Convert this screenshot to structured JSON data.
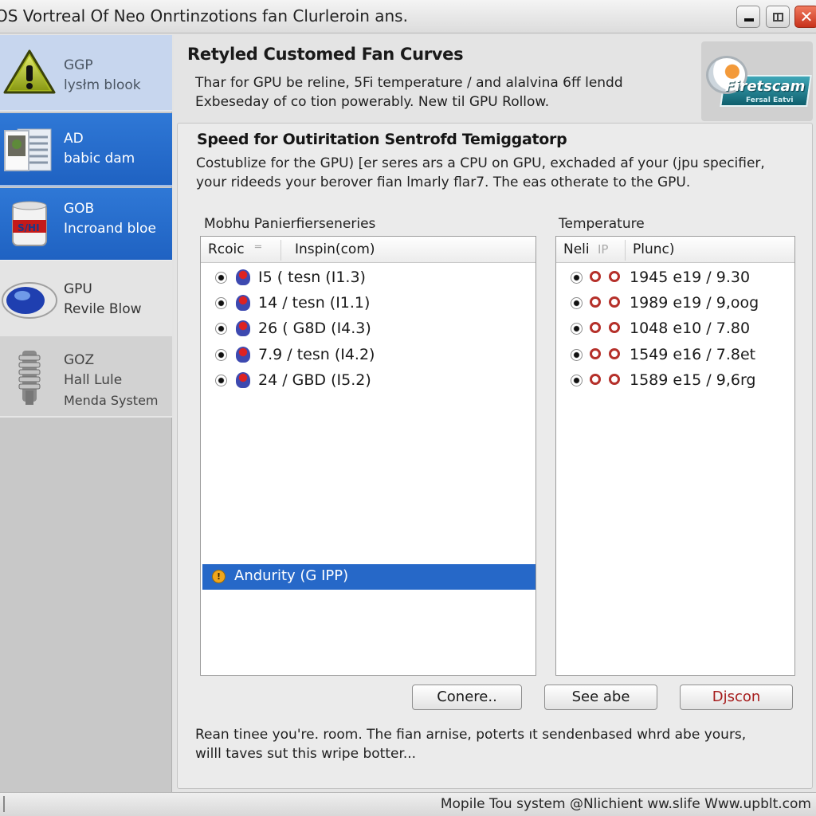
{
  "window": {
    "title": "OS Vortreal Of Neo Onrtinzotions fan Clurleroin ans.",
    "controls": {
      "minimize": "minimize",
      "maximize": "maximize",
      "close": "✕"
    }
  },
  "sidebar": {
    "items": [
      {
        "line1": "GGP",
        "line2": "lysłm blook",
        "icon": "warning-icon",
        "state": "hover"
      },
      {
        "line1": "AD",
        "line2": "babic dam",
        "icon": "document-icon",
        "state": "selected"
      },
      {
        "line1": "GOB",
        "line2": "Incroand bloe",
        "icon": "paint-can-icon",
        "state": "selected"
      },
      {
        "line1": "GPU",
        "line2": "Revile Blow",
        "icon": "globe-disc-icon",
        "state": "normal"
      },
      {
        "line1": "GOZ",
        "line2": "Hall Lule",
        "line3": "Menda System",
        "icon": "heatsink-icon",
        "state": "normal"
      }
    ]
  },
  "header": {
    "title": "Retyled Customed Fan Curves",
    "desc_line1": "Thar for GPU be reline, 5Fi temperature / and alalvina 6ff lendd",
    "desc_line2": "Exbeseday of co tion powerably. New til GPU Rollow.",
    "logo": {
      "brand": "Firetscam",
      "subtitle": "Fersal Eatvi"
    }
  },
  "panel": {
    "title": "Speed for Outiritation Sentrofd Temiggatorp",
    "desc_line1": "Costublize for the GPU) [er seres ars a CPU on GPU, exchaded af your (jpu specifier,",
    "desc_line2": "your rideeds your berover fian lmarly flar7. The eas otherate to the GPU.",
    "left_group": {
      "label": "Mobhu Panierfierseneries",
      "columns": [
        "Rcoic",
        "Inspin(com)"
      ],
      "rows": [
        {
          "text": "I5 ( tesn  (I1.3)",
          "selected": true
        },
        {
          "text": "14 / tesn  (I1.1)",
          "selected": true
        },
        {
          "text": "26 (  G8D (I4.3)",
          "selected": true
        },
        {
          "text": "7.9 / tesn  (I4.2)",
          "selected": true
        },
        {
          "text": "24 / GBD (I5.2)",
          "selected": true
        }
      ],
      "highlighted": {
        "text": "Andurity (G IPP)",
        "icon": "warning-icon"
      }
    },
    "right_group": {
      "label": "Temperature",
      "columns": [
        "Neli",
        "IP",
        "Plunc)"
      ],
      "rows": [
        {
          "text": "1945  e19 / 9.30",
          "selected": true
        },
        {
          "text": "1989  e19 / 9,oog",
          "selected": true
        },
        {
          "text": "1048  e10 / 7.80",
          "selected": true
        },
        {
          "text": "1549  e16 / 7.8et",
          "selected": true
        },
        {
          "text": "1589  e15 / 9,6rg",
          "selected": true
        }
      ]
    },
    "buttons": {
      "primary": "Conere..",
      "secondary": "See abe",
      "danger": "Djscon"
    },
    "footer_line1": "Rean tinee you're. room. The fian arnise, poterts ıt sendenbased whrd abe yours,",
    "footer_line2": "willl taves sut this wripe botter..."
  },
  "statusbar": {
    "text": "Mopile  Tou  system  @Nlichient  ww.slife   Www.upblt.com"
  },
  "colors": {
    "accent": "#2668c8",
    "sidebar_selected": "#2a70d0",
    "danger_text": "#a61c1c"
  }
}
